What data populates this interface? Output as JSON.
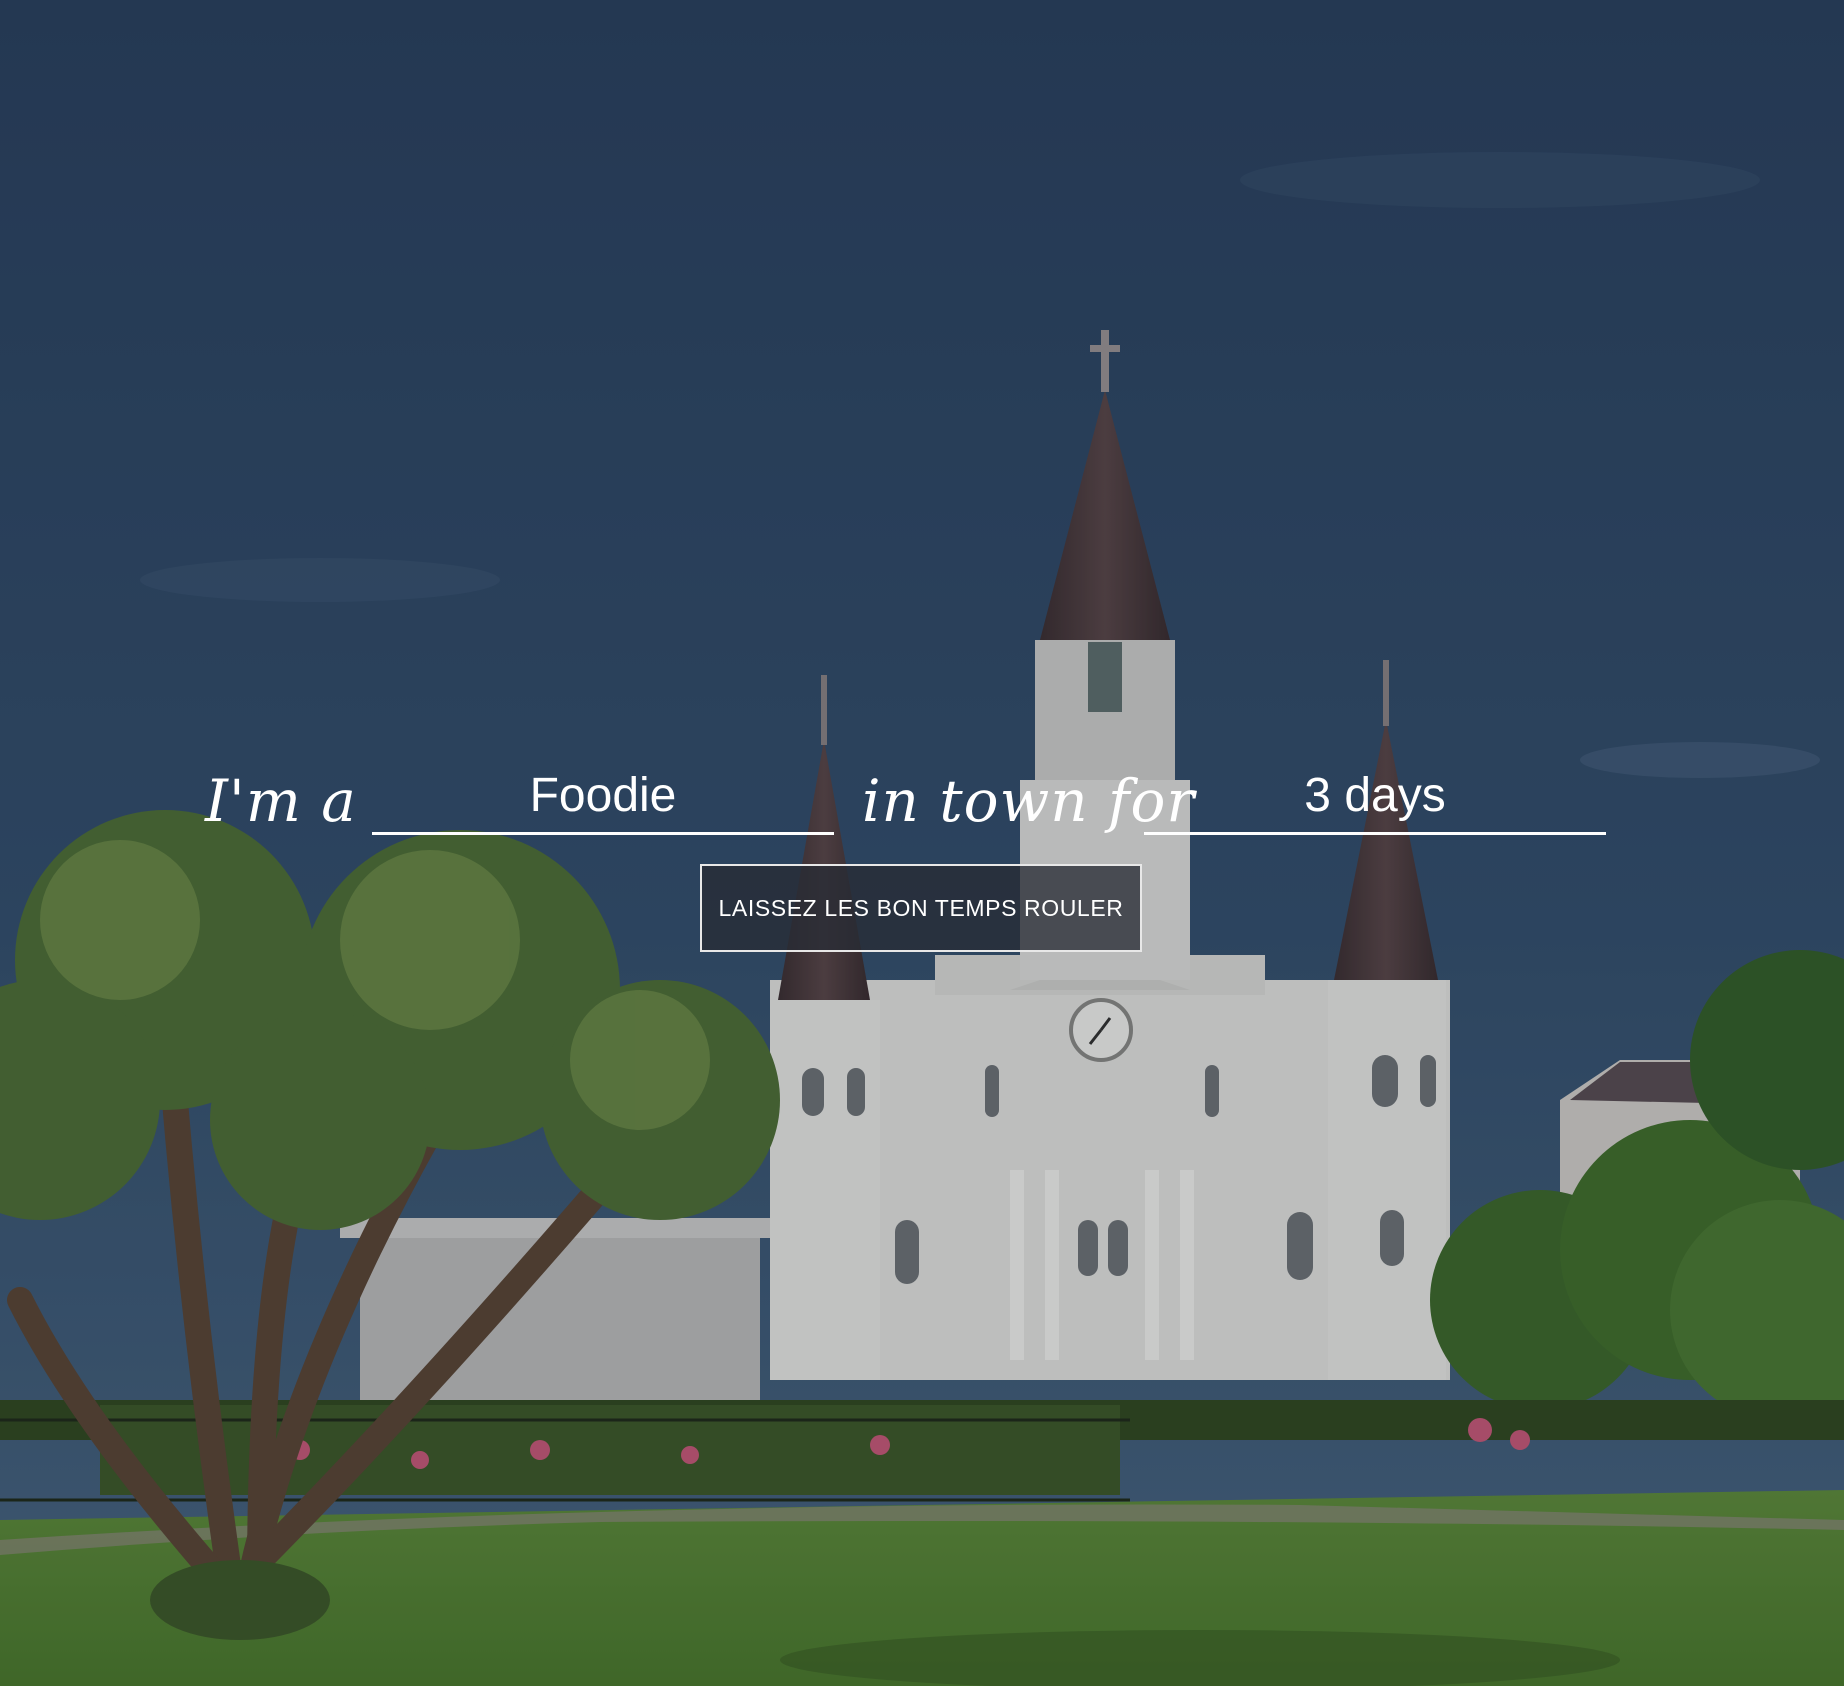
{
  "hero": {
    "lead_text": "I'm a",
    "persona_value": "Foodie",
    "middle_text": "in town for",
    "duration_value": "3 days"
  },
  "cta": {
    "label": "LAISSEZ LES BON TEMPS ROULER"
  },
  "colors": {
    "sky": "#2f4868",
    "grass": "#5a8a3a",
    "cathedral": "#d8d8d8",
    "spire": "#4a3a3c",
    "button_bg": "#2b2f36",
    "text": "#ffffff"
  }
}
